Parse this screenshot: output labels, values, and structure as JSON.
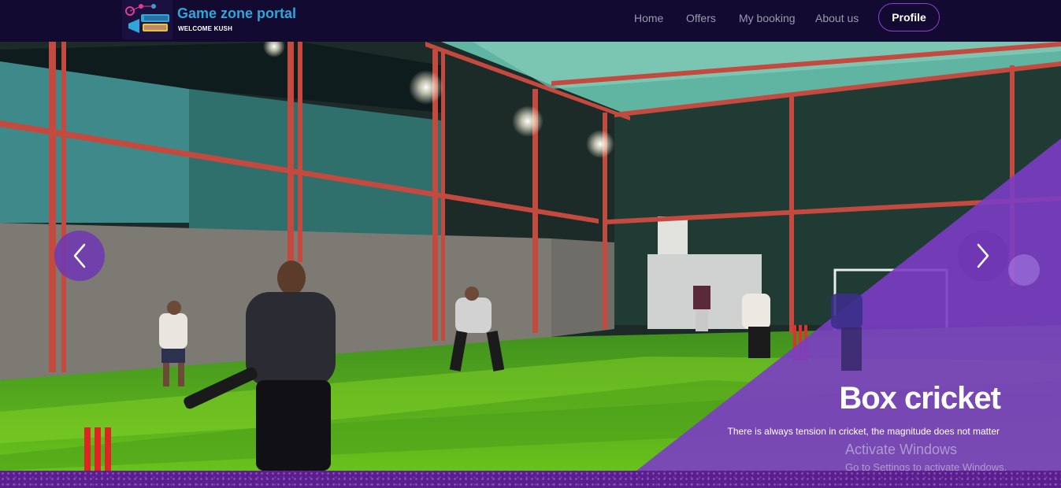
{
  "brand": {
    "title": "Game zone portal",
    "welcome": "WELCOME KUSH",
    "logo_icon": "game-zone-logo-icon"
  },
  "nav": {
    "links": [
      {
        "label": "Home"
      },
      {
        "label": "Offers"
      },
      {
        "label": "My booking"
      },
      {
        "label": "About us"
      }
    ],
    "profile_label": "Profile"
  },
  "hero": {
    "slide_title": "Box cricket",
    "slide_caption": "There is always tension in cricket, the magnitude does not matter",
    "prev_icon": "chevron-left-icon",
    "next_icon": "chevron-right-icon",
    "watermark_title": "Activate Windows",
    "watermark_subtitle": "Go to Settings to activate Windows."
  },
  "colors": {
    "navbar_bg": "#120a30",
    "brand_title": "#2fa6d9",
    "accent_purple": "#7b3dc4",
    "profile_border": "#8f3fd6"
  }
}
